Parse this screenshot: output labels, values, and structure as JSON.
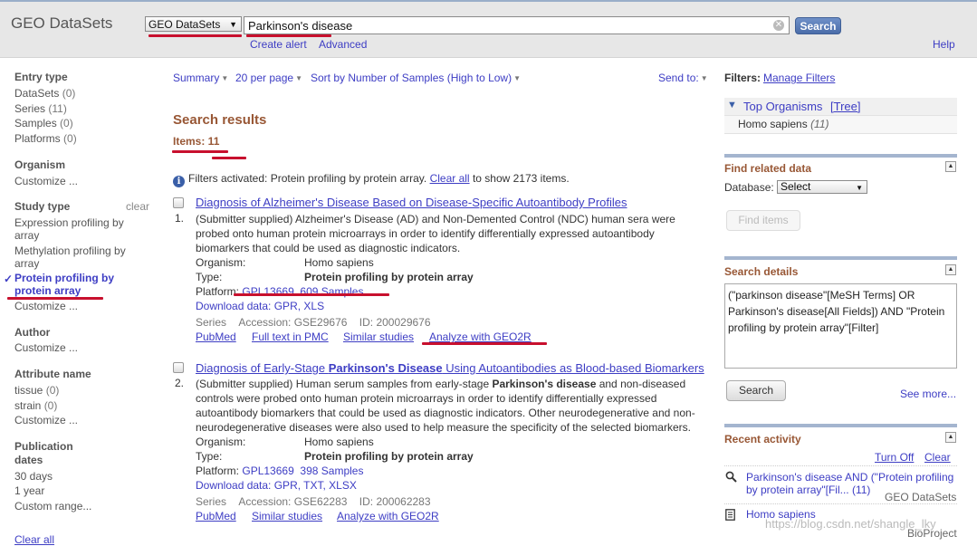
{
  "header": {
    "app_title": "GEO DataSets",
    "db_selected": "GEO DataSets",
    "search_value": "Parkinson's disease",
    "search_button": "Search",
    "create_alert": "Create alert",
    "advanced": "Advanced",
    "help": "Help"
  },
  "sidebar": {
    "entry_type": {
      "heading": "Entry type",
      "items": [
        {
          "label": "DataSets",
          "count": "(0)"
        },
        {
          "label": "Series",
          "count": "(11)"
        },
        {
          "label": "Samples",
          "count": "(0)"
        },
        {
          "label": "Platforms",
          "count": "(0)"
        }
      ]
    },
    "organism": {
      "heading": "Organism",
      "customize": "Customize ..."
    },
    "study_type": {
      "heading": "Study type",
      "clear": "clear",
      "items": [
        "Expression profiling by array",
        "Methylation profiling by array"
      ],
      "selected": "Protein profiling by protein array",
      "check": "✓",
      "customize": "Customize ..."
    },
    "author": {
      "heading": "Author",
      "customize": "Customize ..."
    },
    "attribute": {
      "heading": "Attribute name",
      "items": [
        {
          "label": "tissue",
          "count": "(0)"
        },
        {
          "label": "strain",
          "count": "(0)"
        }
      ],
      "customize": "Customize ..."
    },
    "pubdates": {
      "heading": "Publication dates",
      "items": [
        "30 days",
        "1 year",
        "Custom range..."
      ]
    },
    "clear_all": "Clear all"
  },
  "controls": {
    "summary": "Summary",
    "per_page": "20 per page",
    "sort": "Sort by Number of Samples (High to Low)",
    "send_to": "Send to:"
  },
  "results": {
    "title": "Search results",
    "items_label": "Items: 11",
    "filters_note": "Filters activated: Protein profiling by protein array.",
    "clear_all": "Clear all",
    "show_all": "to show 2173 items.",
    "list": [
      {
        "num": "1.",
        "title": "Diagnosis of Alzheimer's Disease Based on Disease-Specific Autoantibody Profiles",
        "desc": "(Submitter supplied) Alzheimer's Disease (AD) and Non-Demented Control (NDC) human sera were probed onto human protein microarrays in order to identify differentially expressed autoantibody biomarkers that could be used as diagnostic indicators.",
        "organism_label": "Organism:",
        "organism": "Homo sapiens",
        "type_label": "Type:",
        "type": "Protein profiling by protein array",
        "platform_label": "Platform:",
        "platform": "GPL13669",
        "samples": "609 Samples",
        "download": "Download data: GPR, XLS",
        "series": "Series",
        "accession": "Accession: GSE29676",
        "id": "ID: 200029676",
        "links": [
          "PubMed",
          "Full text in PMC",
          "Similar studies",
          "Analyze with GEO2R"
        ]
      },
      {
        "num": "2.",
        "title_pre": "Diagnosis of Early-Stage ",
        "title_bold": "Parkinson's Disease",
        "title_post": " Using Autoantibodies as Blood-based Biomarkers",
        "desc_pre": "(Submitter supplied) Human serum samples from early-stage ",
        "desc_bold": "Parkinson's disease",
        "desc_post": " and non-diseased controls were probed onto human protein microarrays in order to identify differentially expressed autoantibody biomarkers that could be used as diagnostic indicators. Other neurodegenerative and non-neurodegenerative diseases were also used to help measure the specificity of the selected biomarkers.",
        "organism_label": "Organism:",
        "organism": "Homo sapiens",
        "type_label": "Type:",
        "type": "Protein profiling by protein array",
        "platform_label": "Platform:",
        "platform": "GPL13669",
        "samples": "398 Samples",
        "download": "Download data: GPR, TXT, XLSX",
        "series": "Series",
        "accession": "Accession: GSE62283",
        "id": "ID: 200062283",
        "links": [
          "PubMed",
          "Similar studies",
          "Analyze with GEO2R"
        ]
      }
    ]
  },
  "right": {
    "filters_label": "Filters:",
    "manage_filters": "Manage Filters",
    "top_organisms": "Top Organisms",
    "tree": "[Tree]",
    "organism_item": "Homo sapiens",
    "organism_count": "(11)",
    "find_related": {
      "heading": "Find related data",
      "db_label": "Database:",
      "db_value": "Select",
      "button": "Find items"
    },
    "search_details": {
      "heading": "Search details",
      "query": "(\"parkinson disease\"[MeSH Terms] OR Parkinson's disease[All Fields]) AND \"Protein profiling by protein array\"[Filter]",
      "button": "Search",
      "see_more": "See more..."
    },
    "recent": {
      "heading": "Recent activity",
      "turn_off": "Turn Off",
      "clear": "Clear",
      "items": [
        {
          "text": "Parkinson's disease AND (\"Protein profiling by protein array\"[Fil... (11)",
          "source": "GEO DataSets",
          "icon": "search-icon"
        },
        {
          "text": "Homo sapiens",
          "source": "BioProject",
          "icon": "document-icon"
        }
      ]
    }
  },
  "watermark": "https://blog.csdn.net/shangle_lky"
}
